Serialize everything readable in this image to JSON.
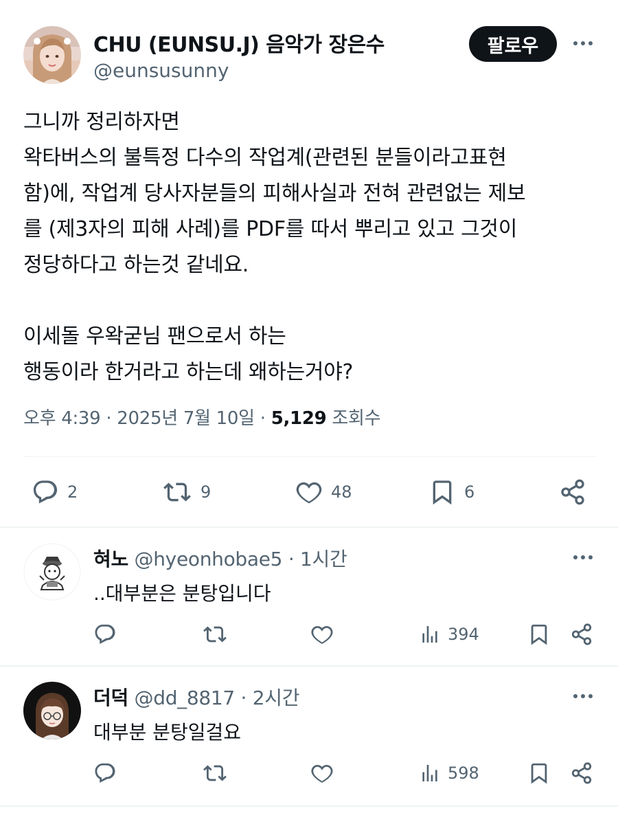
{
  "tweet": {
    "author_name": "CHU (EUNSU.J) 음악가 장은수",
    "author_handle": "@eunsusunny",
    "follow_label": "팔로우",
    "lines": [
      "그니까 정리하자면",
      "왁타버스의 불특정 다수의 작업계(관련된 분들이라고표현",
      "함)에, 작업계 당사자분들의 피해사실과 전혀 관련없는 제보",
      "를 (제3자의 피해 사례)를 PDF를 따서 뿌리고 있고 그것이",
      "정당하다고 하는것 같네요.",
      "",
      "이세돌 우왁굳님 팬으로서 하는",
      "행동이라 한거라고 하는데 왜하는거야?"
    ],
    "time": "오후 4:39",
    "date": "2025년 7월 10일",
    "views_count": "5,129",
    "views_label": "조회수",
    "separator": "·",
    "actions": {
      "replies": "2",
      "retweets": "9",
      "likes": "48",
      "bookmarks": "6"
    }
  },
  "replies": [
    {
      "name": "혀노",
      "handle": "@hyeonhobae5",
      "time": "1시간",
      "text": "..대부분은 분탕입니다",
      "views": "394"
    },
    {
      "name": "더덕",
      "handle": "@dd_8817",
      "time": "2시간",
      "text": "대부분 분탕일걸요",
      "views": "598"
    }
  ],
  "icons": [
    "reply-icon",
    "retweet-icon",
    "like-icon",
    "bookmark-icon",
    "share-icon",
    "views-icon",
    "more-icon"
  ],
  "colors": {
    "text": "#0f1419",
    "secondary": "#536471",
    "divider": "#eff3f4",
    "follow_bg": "#0f1419"
  }
}
